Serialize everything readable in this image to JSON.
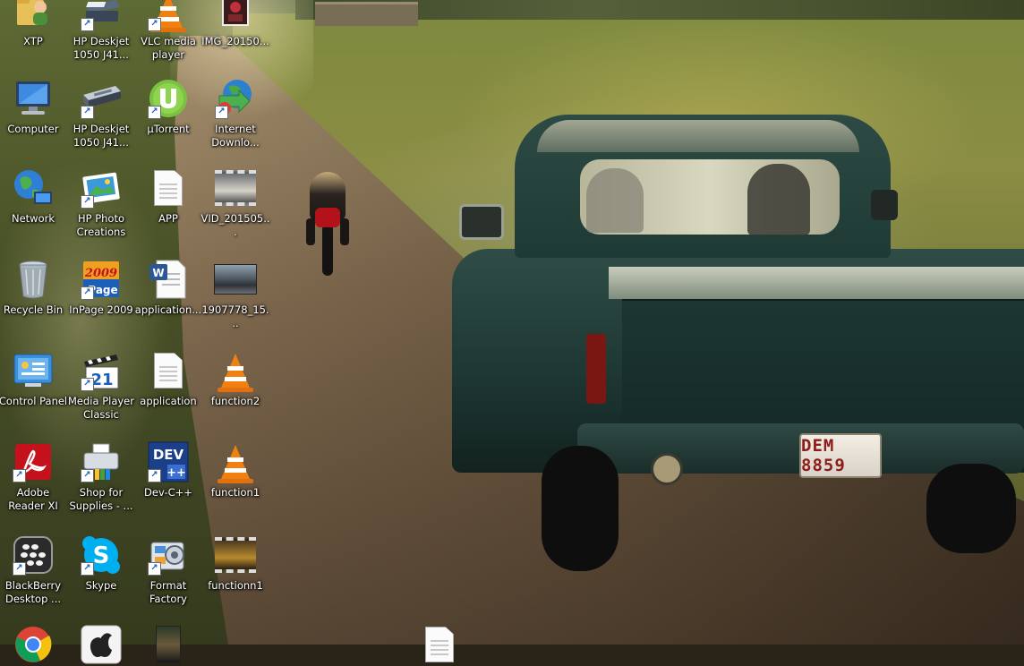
{
  "desktop": {
    "icons": [
      {
        "label": "XTP",
        "icon": "folder-user-icon"
      },
      {
        "label": "HP Deskjet 1050 J41...",
        "icon": "printer-icon"
      },
      {
        "label": "VLC media player",
        "icon": "vlc-cone-icon"
      },
      {
        "label": "IMG_20150...",
        "icon": "image-file-icon"
      },
      {
        "label": "Computer",
        "icon": "computer-icon"
      },
      {
        "label": "HP Deskjet 1050 J41...",
        "icon": "scanner-icon"
      },
      {
        "label": "µTorrent",
        "icon": "utorrent-icon"
      },
      {
        "label": "Internet Downlo...",
        "icon": "idm-globe-icon"
      },
      {
        "label": "Network",
        "icon": "network-globe-icon"
      },
      {
        "label": "HP Photo Creations",
        "icon": "photo-icon"
      },
      {
        "label": "APP",
        "icon": "text-file-icon"
      },
      {
        "label": "VID_201505...",
        "icon": "video-file-icon"
      },
      {
        "label": "Recycle Bin",
        "icon": "recycle-bin-icon"
      },
      {
        "label": "InPage 2009",
        "icon": "inpage-icon"
      },
      {
        "label": "application...",
        "icon": "word-doc-icon"
      },
      {
        "label": "1907778_15...",
        "icon": "photo-thumbnail-icon"
      },
      {
        "label": "Control Panel",
        "icon": "control-panel-icon"
      },
      {
        "label": "Media Player Classic",
        "icon": "media-player-classic-icon"
      },
      {
        "label": "application",
        "icon": "text-file-icon"
      },
      {
        "label": "function2",
        "icon": "vlc-cone-icon"
      },
      {
        "label": "Adobe Reader XI",
        "icon": "adobe-reader-icon"
      },
      {
        "label": "Shop for Supplies - ...",
        "icon": "hp-supplies-icon"
      },
      {
        "label": "Dev-C++",
        "icon": "dev-cpp-icon"
      },
      {
        "label": "function1",
        "icon": "vlc-cone-icon"
      },
      {
        "label": "BlackBerry Desktop ...",
        "icon": "blackberry-icon"
      },
      {
        "label": "Skype",
        "icon": "skype-icon"
      },
      {
        "label": "Format Factory",
        "icon": "format-factory-icon"
      },
      {
        "label": "functionn1",
        "icon": "video-file-icon"
      }
    ],
    "partial_icons": [
      "chrome-icon",
      "apple-icon",
      "photo-thumbnail-icon",
      "text-file-icon"
    ]
  },
  "wallpaper": {
    "plate_text": "DEM 8859",
    "colors": {
      "truck": "#1f3a35",
      "field": "#7e8a3f",
      "road": "#8c7558"
    }
  }
}
